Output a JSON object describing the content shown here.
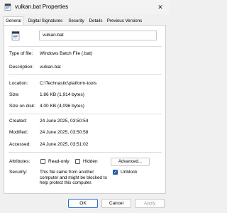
{
  "window": {
    "title": "vulkan.bat Properties",
    "close_glyph": "✕"
  },
  "tabs": [
    {
      "label": "General",
      "active": true
    },
    {
      "label": "Digital Signatures",
      "active": false
    },
    {
      "label": "Security",
      "active": false
    },
    {
      "label": "Details",
      "active": false
    },
    {
      "label": "Previous Versions",
      "active": false
    }
  ],
  "general": {
    "file_name": "vulkan.bat",
    "type_label": "Type of file:",
    "type_value": "Windows Batch File (.bat)",
    "description_label": "Description:",
    "description_value": "vulkan.bat",
    "location_label": "Location:",
    "location_value": "C:\\Technastic\\platform-tools",
    "size_label": "Size:",
    "size_value": "1.86 KB (1,914 bytes)",
    "size_on_disk_label": "Size on disk:",
    "size_on_disk_value": "4.00 KB (4,096 bytes)",
    "created_label": "Created:",
    "created_value": "24 June 2025, 03:50:54",
    "modified_label": "Modified:",
    "modified_value": "24 June 2025, 03:50:58",
    "accessed_label": "Accessed:",
    "accessed_value": "24 June 2025, 03:51:02",
    "attributes_label": "Attributes:",
    "readonly_label": "Read-only",
    "readonly_checked": false,
    "hidden_label": "Hidden",
    "hidden_checked": false,
    "advanced_label": "Advanced...",
    "security_label": "Security:",
    "security_text": "This file came from another computer and might be blocked to help protect this computer.",
    "unblock_label": "Unblock",
    "unblock_checked": true
  },
  "buttons": {
    "ok": "OK",
    "cancel": "Cancel",
    "apply": "Apply"
  },
  "colors": {
    "accent": "#1f5fae",
    "panel": "#ffffff",
    "chrome": "#f0f0f0"
  }
}
